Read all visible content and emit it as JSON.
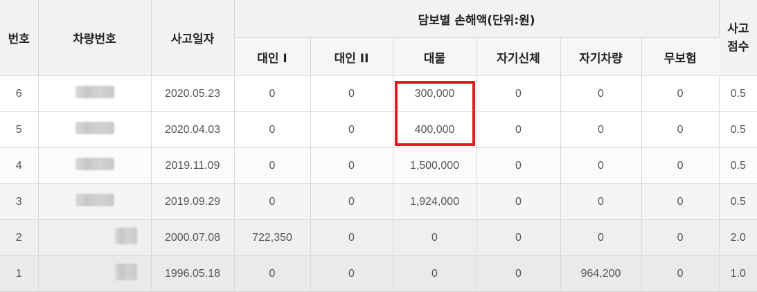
{
  "header": {
    "no": "번호",
    "vehicle": "차량번호",
    "date": "사고일자",
    "group": "담보별 손해액(단위:원)",
    "accident_line1": "사고",
    "accident_line2": "점수",
    "sub": [
      "대인 I",
      "대인 II",
      "대물",
      "자기신체",
      "자기차량",
      "무보험"
    ]
  },
  "rows": [
    {
      "no": "6",
      "date": "2020.05.23",
      "v": [
        "0",
        "0",
        "300,000",
        "0",
        "0",
        "0"
      ],
      "score": "0.5"
    },
    {
      "no": "5",
      "date": "2020.04.03",
      "v": [
        "0",
        "0",
        "400,000",
        "0",
        "0",
        "0"
      ],
      "score": "0.5"
    },
    {
      "no": "4",
      "date": "2019.11.09",
      "v": [
        "0",
        "0",
        "1,500,000",
        "0",
        "0",
        "0"
      ],
      "score": "0.5"
    },
    {
      "no": "3",
      "date": "2019.09.29",
      "v": [
        "0",
        "0",
        "1,924,000",
        "0",
        "0",
        "0"
      ],
      "score": "0.5"
    },
    {
      "no": "2",
      "date": "2000.07.08",
      "v": [
        "722,350",
        "0",
        "0",
        "0",
        "0",
        "0"
      ],
      "score": "2.0"
    },
    {
      "no": "1",
      "date": "1996.05.18",
      "v": [
        "0",
        "0",
        "0",
        "0",
        "964,200",
        "0"
      ],
      "score": "1.0"
    }
  ],
  "colors": {
    "header_bg": "#f1f2f4",
    "highlight": "#e21b23",
    "text": "#555555"
  }
}
